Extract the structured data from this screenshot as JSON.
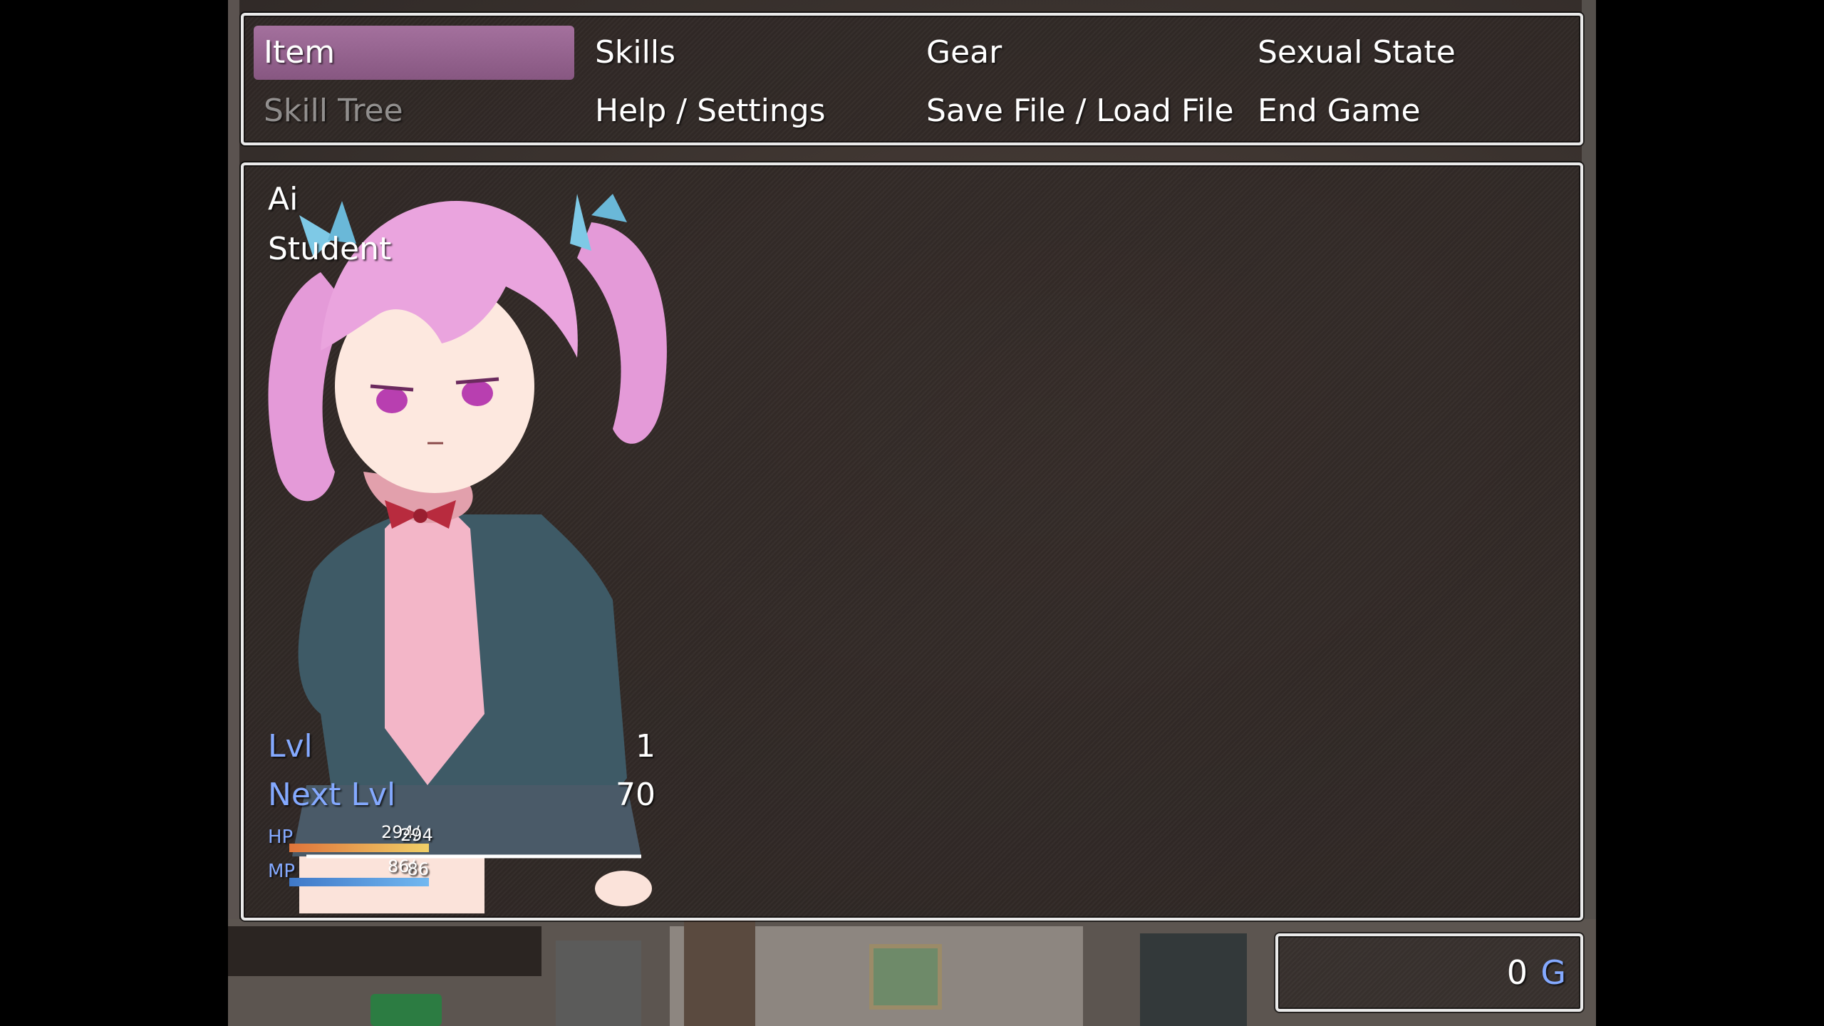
{
  "menu": {
    "commands": [
      {
        "label": "Item",
        "selected": true,
        "enabled": true
      },
      {
        "label": "Skills",
        "selected": false,
        "enabled": true
      },
      {
        "label": "Gear",
        "selected": false,
        "enabled": true
      },
      {
        "label": "Sexual State",
        "selected": false,
        "enabled": true
      },
      {
        "label": "Skill Tree",
        "selected": false,
        "enabled": false
      },
      {
        "label": "Help / Settings",
        "selected": false,
        "enabled": true
      },
      {
        "label": "Save File / Load File",
        "selected": false,
        "enabled": true
      },
      {
        "label": "End Game",
        "selected": false,
        "enabled": true
      }
    ]
  },
  "actor": {
    "name": "Ai",
    "class": "Student",
    "level_label": "Lvl",
    "level": "1",
    "next_label": "Next Lvl",
    "next": "70",
    "hp_label": "HP",
    "hp_current": "294/",
    "hp_max": "294",
    "hp_fraction": 1.0,
    "mp_label": "MP",
    "mp_current": "86/",
    "mp_max": "86",
    "mp_fraction": 1.0
  },
  "gold": {
    "value": "0",
    "unit": "G"
  },
  "colors": {
    "selection": "#b078aa",
    "system_blue": "#84a9ff",
    "hp_gauge_start": "#e0743a",
    "hp_gauge_end": "#f0d068",
    "mp_gauge_start": "#3f78c8",
    "mp_gauge_end": "#72b8f0"
  }
}
